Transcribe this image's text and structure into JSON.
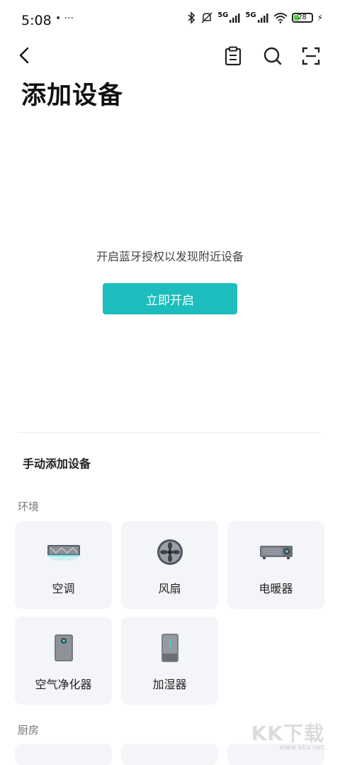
{
  "status_bar": {
    "time": "5:08",
    "left_icons": "• ···",
    "network_1": "5G",
    "network_2": "5G",
    "battery_level": "28",
    "icons": [
      "bluetooth-icon",
      "mute-icon",
      "signal-icon",
      "signal-icon",
      "wifi-icon",
      "battery-icon",
      "charging-icon"
    ]
  },
  "header": {
    "back_icon": "back-arrow-icon",
    "actions": [
      "clipboard-icon",
      "search-icon",
      "scan-icon"
    ]
  },
  "page_title": "添加设备",
  "bluetooth": {
    "prompt": "开启蓝牙授权以发现附近设备",
    "button_label": "立即开启",
    "button_color": "#1cbdbc"
  },
  "manual": {
    "title": "手动添加设备",
    "categories": [
      {
        "label": "环境",
        "devices": [
          {
            "label": "空调",
            "icon": "air-conditioner-icon"
          },
          {
            "label": "风扇",
            "icon": "fan-icon"
          },
          {
            "label": "电暖器",
            "icon": "heater-icon"
          },
          {
            "label": "空气净化器",
            "icon": "air-purifier-icon"
          },
          {
            "label": "加湿器",
            "icon": "humidifier-icon"
          }
        ]
      },
      {
        "label": "厨房",
        "devices": []
      }
    ]
  },
  "watermark": {
    "main": "KK下载",
    "sub": "www.kkx.net"
  }
}
